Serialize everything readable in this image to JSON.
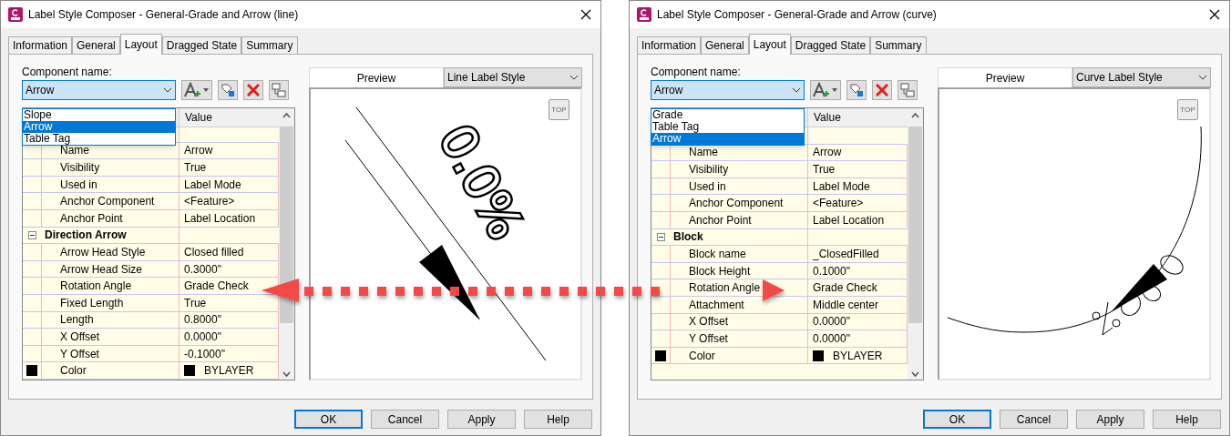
{
  "dialogs": [
    {
      "title": "Label Style Composer - General-Grade and Arrow (line)",
      "tabs": [
        {
          "label": "Information",
          "selected": false
        },
        {
          "label": "General",
          "selected": false
        },
        {
          "label": "Layout",
          "selected": true
        },
        {
          "label": "Dragged State",
          "selected": false
        },
        {
          "label": "Summary",
          "selected": false
        }
      ],
      "component_label": "Component name:",
      "component_value": "Arrow",
      "dropdown_options": [
        {
          "label": "Slope",
          "selected": false
        },
        {
          "label": "Arrow",
          "selected": true
        },
        {
          "label": "Table Tag",
          "selected": false
        }
      ],
      "value_header": "Value",
      "rows": [
        {
          "kind": "group"
        },
        {
          "kind": "property",
          "name": "Name",
          "value": "Arrow"
        },
        {
          "kind": "property",
          "name": "Visibility",
          "value": "True"
        },
        {
          "kind": "property",
          "name": "Used in",
          "value": "Label Mode"
        },
        {
          "kind": "property",
          "name": "Anchor Component",
          "value": "<Feature>"
        },
        {
          "kind": "property",
          "name": "Anchor Point",
          "value": "Label Location"
        },
        {
          "kind": "group",
          "label": "Direction Arrow",
          "expanded": true
        },
        {
          "kind": "property",
          "name": "Arrow Head Style",
          "value": "Closed filled"
        },
        {
          "kind": "property",
          "name": "Arrow Head Size",
          "value": "0.3000\""
        },
        {
          "kind": "property",
          "name": "Rotation Angle",
          "value": "Grade Check"
        },
        {
          "kind": "property",
          "name": "Fixed Length",
          "value": "True"
        },
        {
          "kind": "property",
          "name": "Length",
          "value": "0.8000\""
        },
        {
          "kind": "property",
          "name": "X Offset",
          "value": "0.0000\""
        },
        {
          "kind": "property",
          "name": "Y Offset",
          "value": "-0.1000\""
        },
        {
          "kind": "color",
          "name": "Color",
          "value": "BYLAYER"
        }
      ],
      "preview": {
        "tab": "Preview",
        "style": "Line Label Style",
        "kind": "line",
        "view_button": "TOP",
        "label": "0.0%"
      },
      "buttons": [
        {
          "label": "OK",
          "default": true
        },
        {
          "label": "Cancel",
          "default": false
        },
        {
          "label": "Apply",
          "default": false
        },
        {
          "label": "Help",
          "default": false
        }
      ]
    },
    {
      "title": "Label Style Composer - General-Grade and Arrow (curve)",
      "tabs": [
        {
          "label": "Information",
          "selected": false
        },
        {
          "label": "General",
          "selected": false
        },
        {
          "label": "Layout",
          "selected": true
        },
        {
          "label": "Dragged State",
          "selected": false
        },
        {
          "label": "Summary",
          "selected": false
        }
      ],
      "component_label": "Component name:",
      "component_value": "Arrow",
      "dropdown_options": [
        {
          "label": "Grade",
          "selected": false
        },
        {
          "label": "Table Tag",
          "selected": false
        },
        {
          "label": "Arrow",
          "selected": true
        }
      ],
      "value_header": "Value",
      "rows": [
        {
          "kind": "group"
        },
        {
          "kind": "property",
          "name": "Name",
          "value": "Arrow"
        },
        {
          "kind": "property",
          "name": "Visibility",
          "value": "True"
        },
        {
          "kind": "property",
          "name": "Used in",
          "value": "Label Mode"
        },
        {
          "kind": "property",
          "name": "Anchor Component",
          "value": "<Feature>"
        },
        {
          "kind": "property",
          "name": "Anchor Point",
          "value": "Label Location"
        },
        {
          "kind": "group",
          "label": "Block",
          "expanded": true
        },
        {
          "kind": "property",
          "name": "Block name",
          "value": "_ClosedFilled"
        },
        {
          "kind": "property",
          "name": "Block Height",
          "value": "0.1000\""
        },
        {
          "kind": "property",
          "name": "Rotation Angle",
          "value": "Grade Check"
        },
        {
          "kind": "property",
          "name": "Attachment",
          "value": "Middle center"
        },
        {
          "kind": "property",
          "name": "X Offset",
          "value": "0.0000\""
        },
        {
          "kind": "property",
          "name": "Y Offset",
          "value": "0.0000\""
        },
        {
          "kind": "color",
          "name": "Color",
          "value": "BYLAYER"
        }
      ],
      "preview": {
        "tab": "Preview",
        "style": "Curve Label Style",
        "kind": "curve",
        "view_button": "TOP"
      },
      "buttons": [
        {
          "label": "OK",
          "default": true
        },
        {
          "label": "Cancel",
          "default": false
        },
        {
          "label": "Apply",
          "default": false
        },
        {
          "label": "Help",
          "default": false
        }
      ]
    }
  ]
}
